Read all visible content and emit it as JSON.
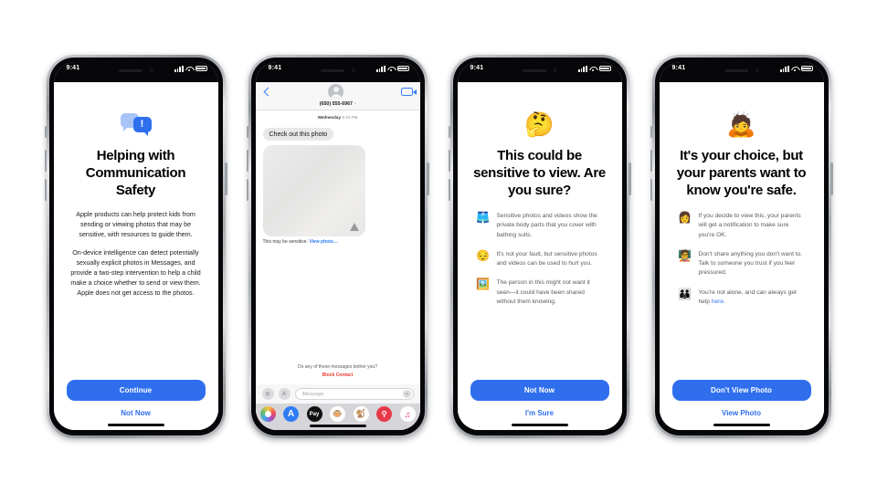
{
  "status_bar": {
    "time": "9:41",
    "signal_icon": "cellular-bars-icon",
    "wifi_icon": "wifi-icon",
    "battery_icon": "battery-icon"
  },
  "phones": [
    {
      "id": "communication-safety-intro",
      "hero_icon": "message-bubbles-alert-icon",
      "headline": "Helping with Communication Safety",
      "paragraphs": [
        "Apple products can help protect kids from sending or viewing photos that may be sensitive, with resources to guide them.",
        "On-device intelligence can detect potentially sexually explicit photos in Messages, and provide a two-step intervention to help a child make a choice whether to send or view them. Apple does not get access to the photos."
      ],
      "primary_button": "Continue",
      "secondary_button": "Not Now"
    },
    {
      "id": "messages-conversation",
      "nav": {
        "back_icon": "back-chevron-icon",
        "avatar_icon": "contact-avatar-icon",
        "facetime_icon": "facetime-video-icon",
        "contact": "(650) 555-6967",
        "contact_chevron": "›"
      },
      "timestamp_day": "Wednesday",
      "timestamp_time": "5:34 PM",
      "incoming_message": "Check out this photo",
      "photo_warning_icon": "warning-triangle-icon",
      "sensitive_notice": "This may be sensitive.",
      "sensitive_link": "View photo…",
      "bother_prompt": "Do any of these messages bother you?",
      "block_contact": "Block Contact",
      "input": {
        "camera_icon": "camera-icon",
        "appstore_icon": "app-store-icon",
        "placeholder": "iMessage",
        "send_icon": "send-arrow-icon"
      },
      "app_drawer": [
        {
          "name": "photos-app-icon",
          "glyph": ""
        },
        {
          "name": "app-store-app-icon",
          "glyph": "A"
        },
        {
          "name": "apple-pay-app-icon",
          "glyph": "Pay"
        },
        {
          "name": "memoji-monkey-icon",
          "glyph": "🐵"
        },
        {
          "name": "animoji-app-icon",
          "glyph": "🐒"
        },
        {
          "name": "image-search-app-icon",
          "glyph": "ⓠ"
        },
        {
          "name": "music-app-icon",
          "glyph": "♫"
        }
      ]
    },
    {
      "id": "sensitive-to-view-warning",
      "hero_icon": "thinking-face-emoji",
      "hero_emoji": "🤔",
      "headline": "This could be sensitive to view. Are you sure?",
      "bullets": [
        {
          "emoji": "🩳",
          "icon_name": "swimsuit-emoji",
          "text": "Sensitive photos and videos show the private body parts that you cover with bathing suits."
        },
        {
          "emoji": "😔",
          "icon_name": "sad-face-emoji",
          "text": "It's not your fault, but sensitive photos and videos can be used to hurt you."
        },
        {
          "emoji": "🖼️",
          "icon_name": "framed-picture-emoji",
          "text": "The person in this might not want it seen—it could have been shared without them knowing."
        }
      ],
      "primary_button": "Not Now",
      "secondary_button": "I'm Sure"
    },
    {
      "id": "parental-notification-choice",
      "hero_icon": "person-gesturing-emoji",
      "hero_emoji": "🙇",
      "headline": "It's your choice, but your parents want to know you're safe.",
      "bullets": [
        {
          "emoji": "👩",
          "icon_name": "notification-avatar-emoji",
          "text": "If you decide to view this, your parents will get a notification to make sure you're OK."
        },
        {
          "emoji": "🧑‍🏫",
          "icon_name": "trusted-adult-emoji",
          "text": "Don't share anything you don't want to. Talk to someone you trust if you feel pressured."
        },
        {
          "emoji": "👪",
          "icon_name": "family-emoji",
          "text_before": "You're not alone, and can always get help ",
          "link": "here",
          "text_after": "."
        }
      ],
      "primary_button": "Don't View Photo",
      "secondary_button": "View Photo"
    }
  ],
  "colors": {
    "accent_blue": "#2f6fed",
    "link_blue": "#2f7df4",
    "alert_red": "#e8392f",
    "bubble_gray": "#e8e8ea"
  }
}
